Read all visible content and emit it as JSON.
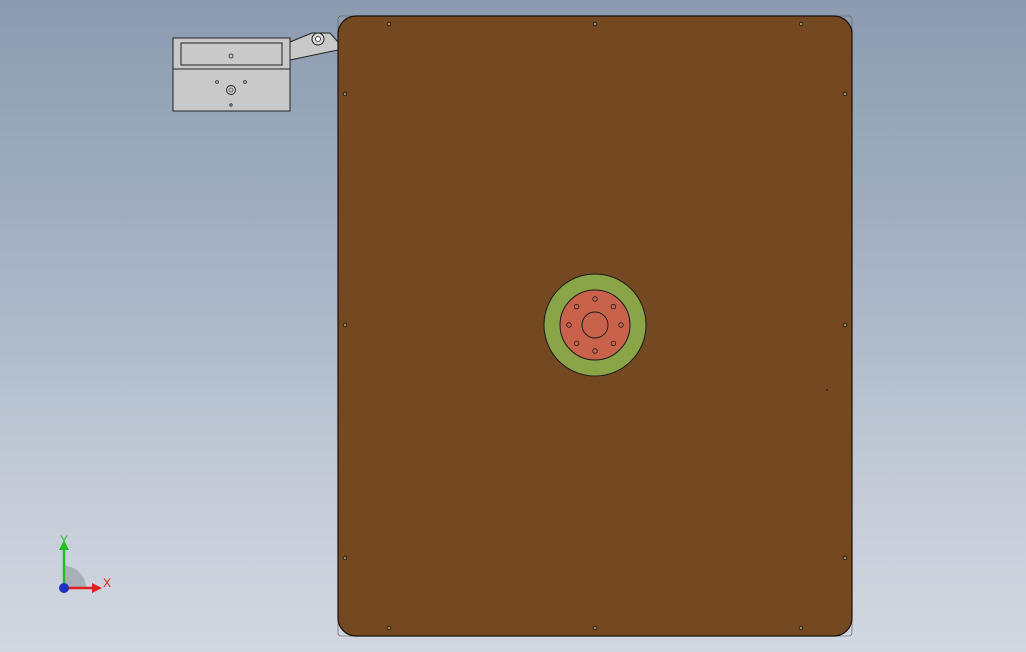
{
  "viewport": {
    "background_top": "#8c9bb0",
    "background_bottom": "#d2d8e1"
  },
  "model": {
    "plate_color": "#744820",
    "plate_outline": "#1a1008",
    "bracket_color": "#c9c9c9",
    "bracket_outline": "#222222",
    "outer_ring_color": "#8aa547",
    "flange_color": "#c8624a",
    "hub_color": "#c8624a",
    "hole_color": "#4a3a2a"
  },
  "triad": {
    "x_label": "X",
    "y_label": "Y",
    "x_color": "#e02020",
    "y_color": "#20c020",
    "z_color": "#2030c0"
  }
}
